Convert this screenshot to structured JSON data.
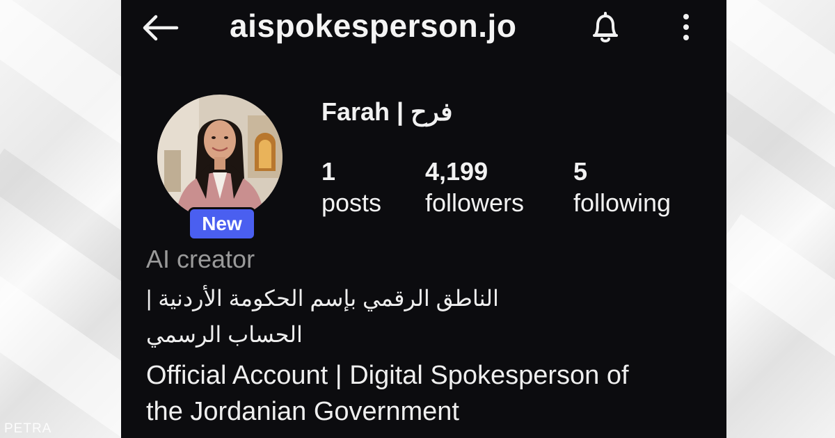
{
  "topbar": {
    "username": "aispokesperson.jo",
    "back_icon": "arrow-left-icon",
    "bell_icon": "bell-icon",
    "menu_icon": "more-vertical-icon"
  },
  "profile": {
    "display_name": "Farah | فرح",
    "badge": "New",
    "category": "AI creator",
    "stats": [
      {
        "value": "1",
        "label": "posts"
      },
      {
        "value": "4,199",
        "label": "followers"
      },
      {
        "value": "5",
        "label": "following"
      }
    ],
    "bio": {
      "arabic_line1": "الناطق الرقمي بإسم الحكومة الأردنية |",
      "arabic_line2": "الحساب الرسمي",
      "english_line1": "Official Account | Digital Spokesperson of",
      "english_line2": "the Jordanian Government"
    }
  },
  "watermark": "PETRA",
  "colors": {
    "screen_bg": "#0c0c0f",
    "badge": "#4a5ff0",
    "category_text": "#9a9a9a"
  }
}
